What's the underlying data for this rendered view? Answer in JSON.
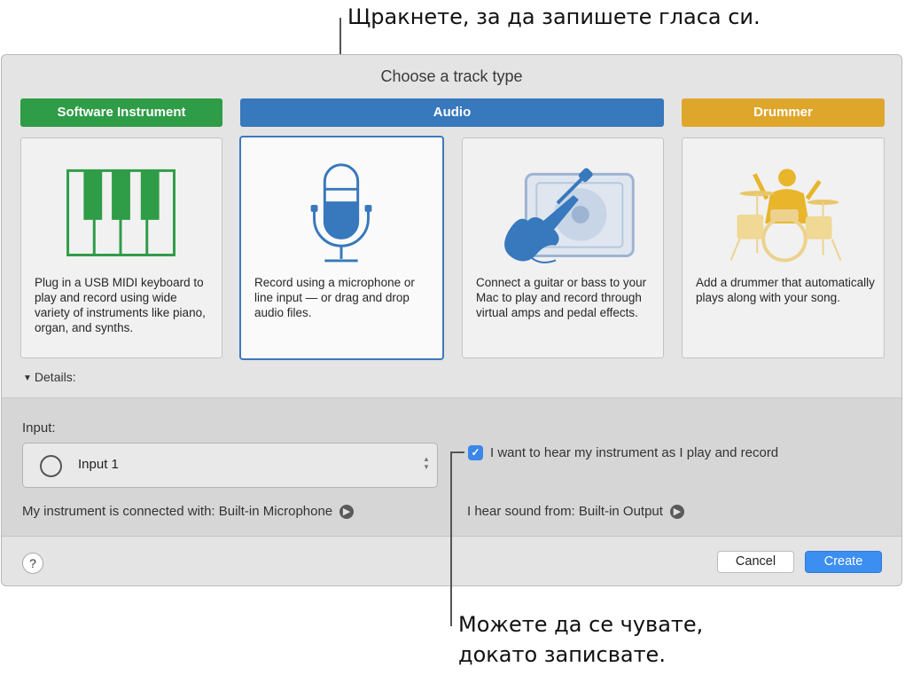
{
  "callouts": {
    "top": "Щракнете, за да запишете гласа си.",
    "bottom": "Можете да се чувате, докато записвате."
  },
  "dialog": {
    "title": "Choose a track type",
    "track_types": [
      {
        "label": "Software Instrument",
        "color": "#2f9c47",
        "description": "Plug in a USB MIDI keyboard to play and record using wide variety of instruments like piano, organ, and synths.",
        "icon": "piano-keyboard-icon"
      },
      {
        "label": "Audio",
        "color": "#3878bc",
        "microphone_description": "Record using a microphone or line input — or drag and drop audio files.",
        "microphone_icon": "microphone-icon",
        "guitar_description": "Connect a guitar or bass to your Mac to play and record through virtual amps and pedal effects.",
        "guitar_icon": "guitar-amp-icon",
        "selected": "microphone"
      },
      {
        "label": "Drummer",
        "color": "#dfa62c",
        "description": "Add a drummer that automatically plays along with your song.",
        "icon": "drummer-icon"
      }
    ],
    "details_label": "Details:",
    "input": {
      "label": "Input:",
      "value": "Input 1"
    },
    "monitoring": {
      "checked": true,
      "label": "I want to hear my instrument as I play and record"
    },
    "connected_with": "My instrument is connected with: Built-in Microphone",
    "output": "I hear sound from: Built-in Output",
    "help_label": "?",
    "cancel_label": "Cancel",
    "create_label": "Create"
  }
}
